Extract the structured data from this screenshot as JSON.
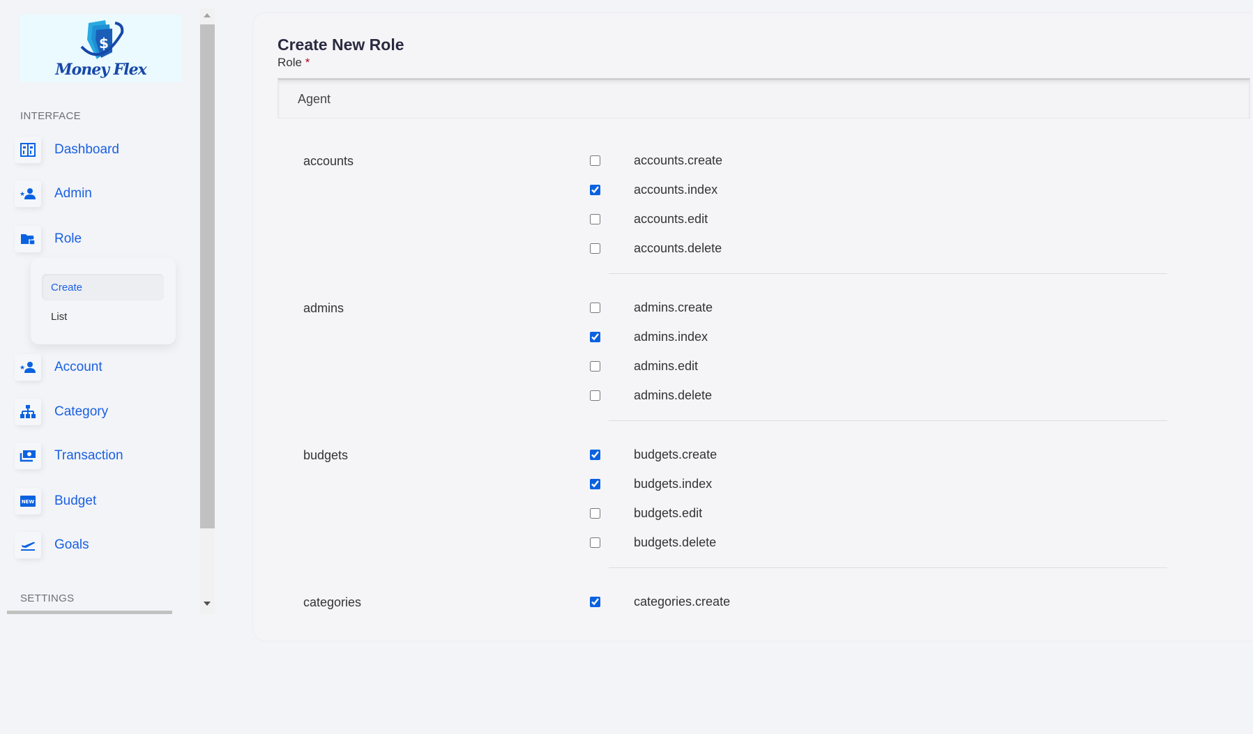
{
  "brand": {
    "name": "Money Flex"
  },
  "sidebar": {
    "section_interface": "INTERFACE",
    "section_settings": "SETTINGS",
    "items": [
      {
        "label": "Dashboard",
        "icon": "dashboard-icon"
      },
      {
        "label": "Admin",
        "icon": "user-star-icon"
      },
      {
        "label": "Role",
        "icon": "folder-lock-icon"
      },
      {
        "label": "Account",
        "icon": "user-star-icon"
      },
      {
        "label": "Category",
        "icon": "sitemap-icon"
      },
      {
        "label": "Transaction",
        "icon": "money-icon"
      },
      {
        "label": "Budget",
        "icon": "new-badge-icon"
      },
      {
        "label": "Goals",
        "icon": "flight-takeoff-icon"
      }
    ],
    "role_submenu": {
      "create": "Create",
      "list": "List",
      "active": "Create"
    }
  },
  "form": {
    "title": "Create New Role",
    "role_label": "Role",
    "required_mark": "*",
    "role_value": "Agent"
  },
  "accent_color": "#0b62e0",
  "permission_groups": [
    {
      "name": "accounts",
      "permissions": [
        {
          "label": "accounts.create",
          "checked": false
        },
        {
          "label": "accounts.index",
          "checked": true
        },
        {
          "label": "accounts.edit",
          "checked": false
        },
        {
          "label": "accounts.delete",
          "checked": false
        }
      ]
    },
    {
      "name": "admins",
      "permissions": [
        {
          "label": "admins.create",
          "checked": false
        },
        {
          "label": "admins.index",
          "checked": true
        },
        {
          "label": "admins.edit",
          "checked": false
        },
        {
          "label": "admins.delete",
          "checked": false
        }
      ]
    },
    {
      "name": "budgets",
      "permissions": [
        {
          "label": "budgets.create",
          "checked": true
        },
        {
          "label": "budgets.index",
          "checked": true
        },
        {
          "label": "budgets.edit",
          "checked": false
        },
        {
          "label": "budgets.delete",
          "checked": false
        }
      ]
    },
    {
      "name": "categories",
      "permissions": [
        {
          "label": "categories.create",
          "checked": true
        }
      ]
    }
  ]
}
